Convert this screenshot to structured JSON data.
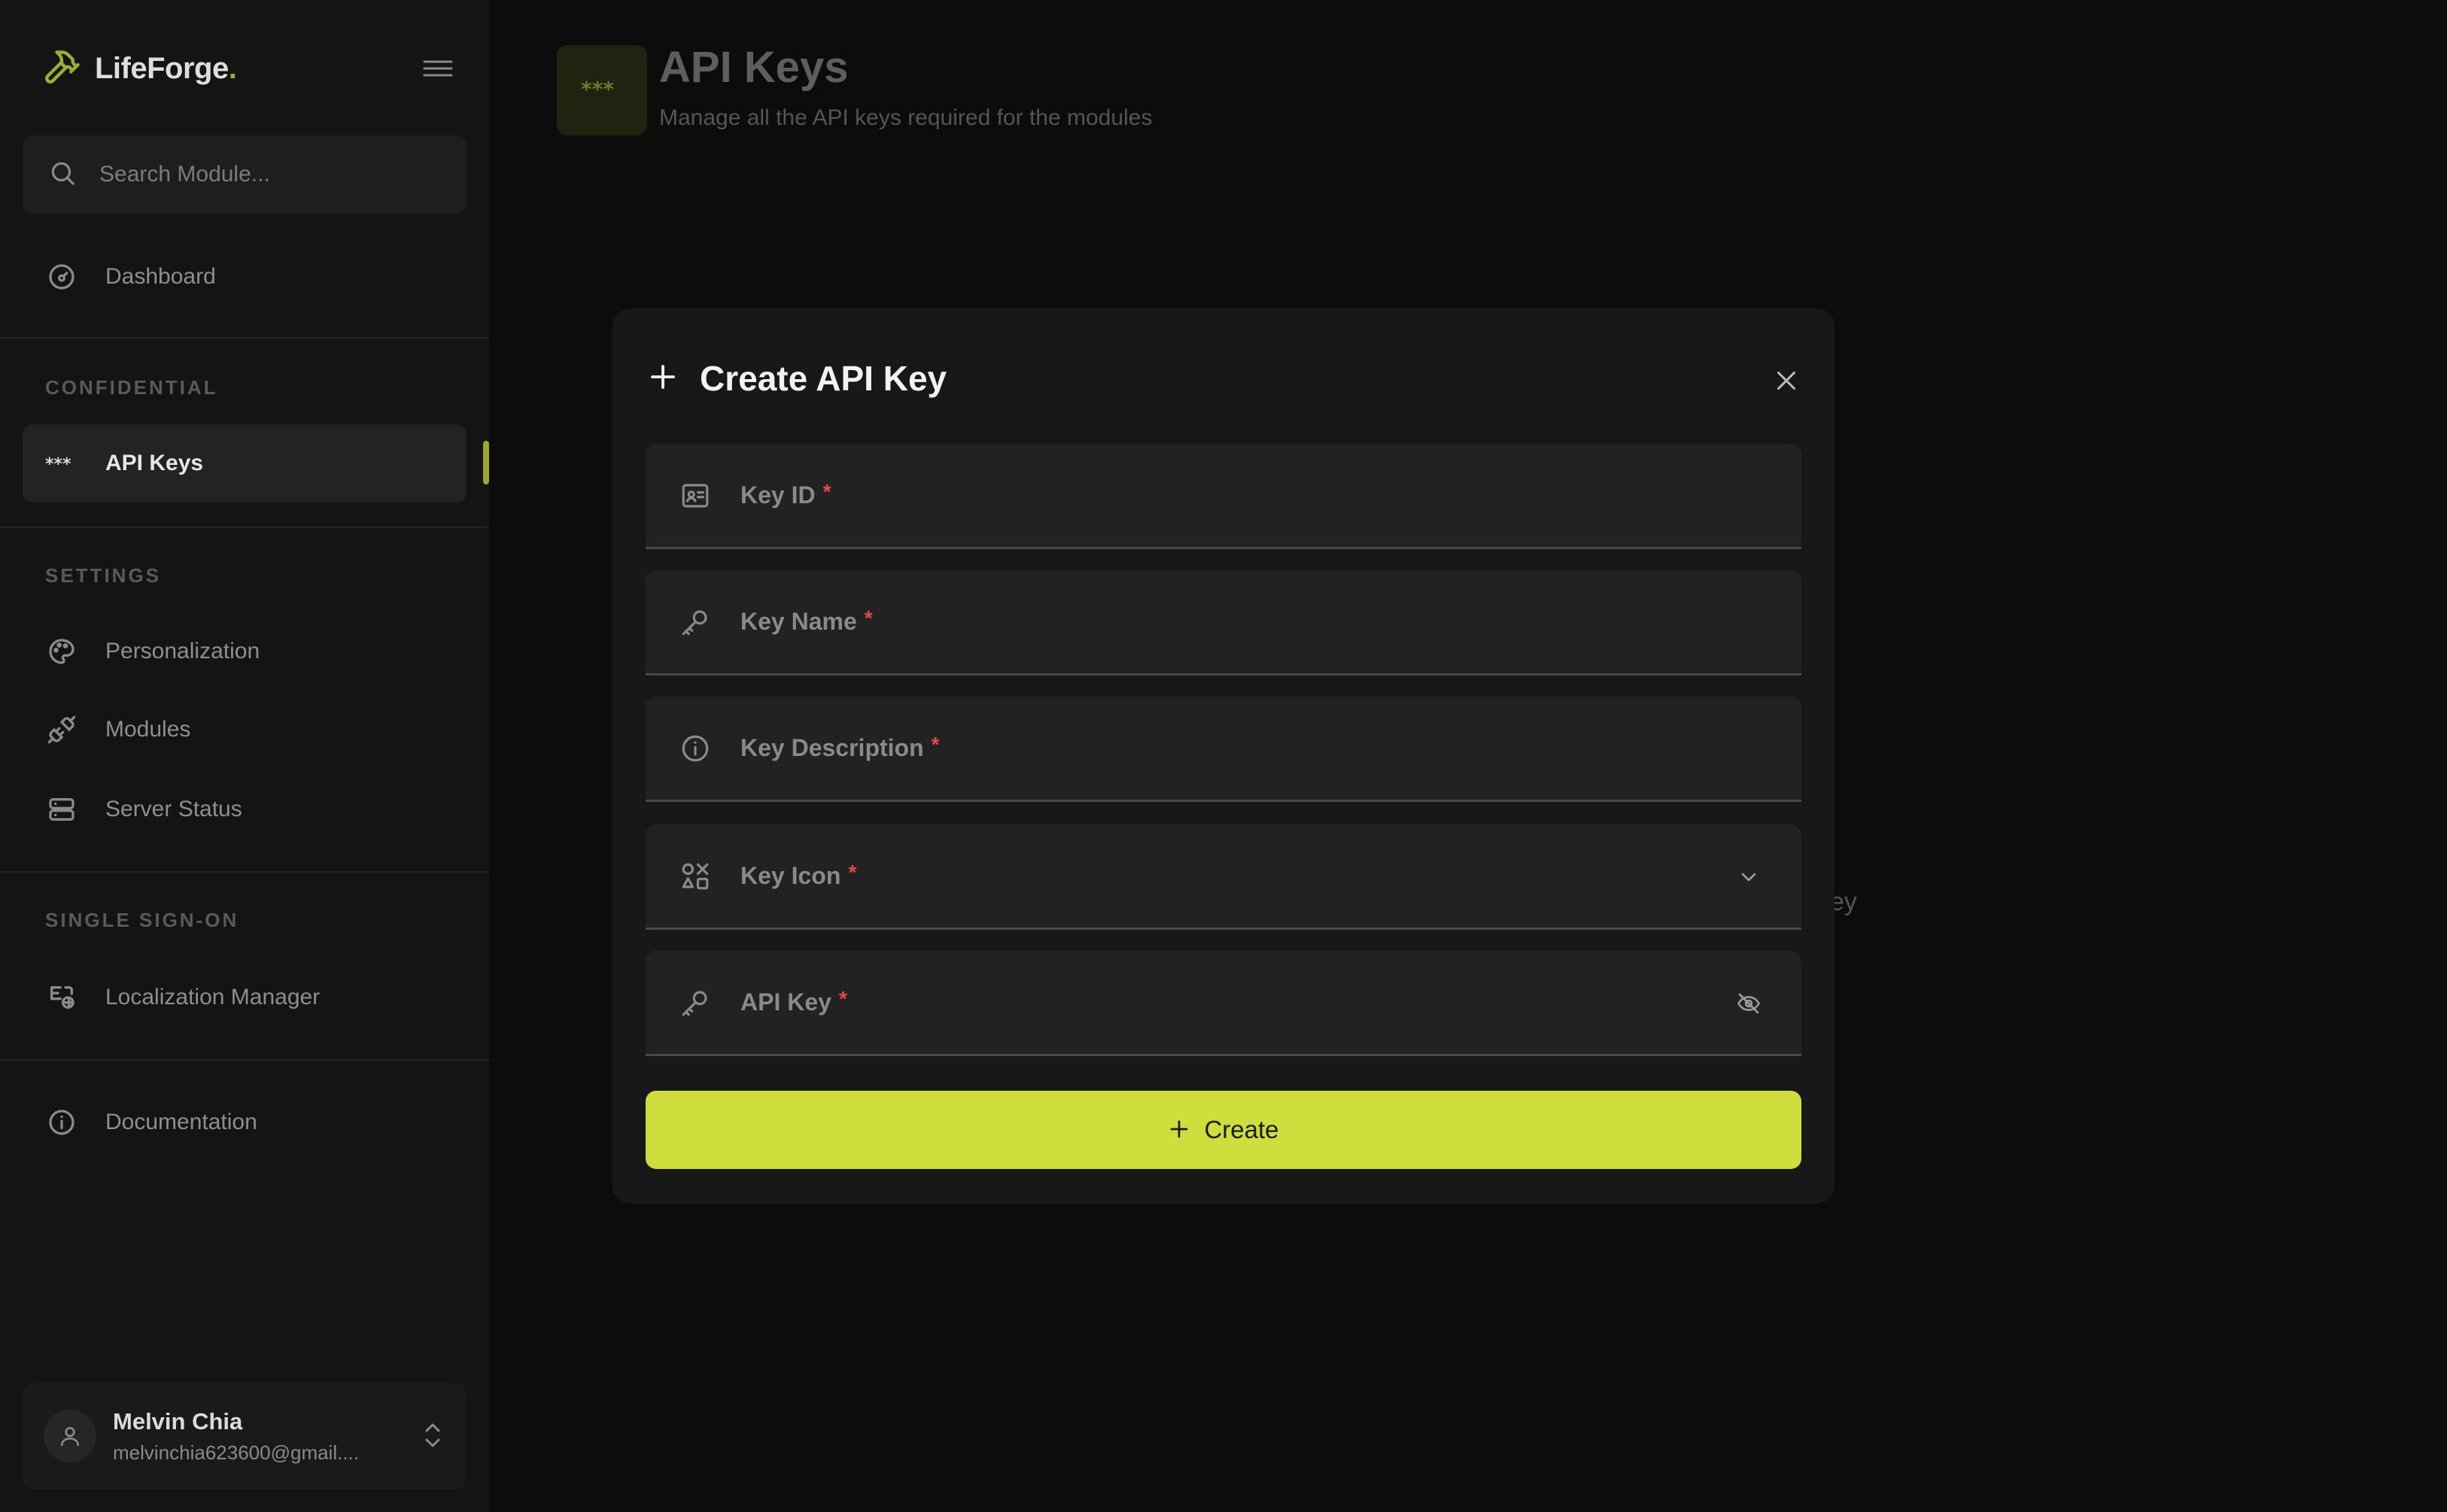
{
  "app": {
    "brand_name": "LifeForge",
    "brand_dot": ".",
    "colors": {
      "accent": "#cede3d",
      "accent_dark": "#9aa82a",
      "required": "#e5484d"
    }
  },
  "sidebar": {
    "search_placeholder": "Search Module...",
    "dashboard": {
      "label": "Dashboard",
      "icon": "dashboard-icon"
    },
    "sections": {
      "confidential": "CONFIDENTIAL",
      "settings": "SETTINGS",
      "sso": "SINGLE SIGN-ON"
    },
    "items": {
      "api_keys": {
        "label": "API Keys",
        "icon": "asterisks-icon",
        "active": true
      },
      "personalization": {
        "label": "Personalization",
        "icon": "palette-icon"
      },
      "modules": {
        "label": "Modules",
        "icon": "plug-icon"
      },
      "server_status": {
        "label": "Server Status",
        "icon": "server-icon"
      },
      "localization": {
        "label": "Localization Manager",
        "icon": "language-icon"
      },
      "documentation": {
        "label": "Documentation",
        "icon": "info-icon"
      }
    },
    "user": {
      "name": "Melvin Chia",
      "email": "melvinchia623600@gmail...."
    }
  },
  "header": {
    "title": "API Keys",
    "subtitle": "Manage all the API keys required for the modules",
    "behind_text": "ey"
  },
  "modal": {
    "title": "Create API Key",
    "fields": {
      "key_id": {
        "label": "Key ID",
        "required": "*",
        "icon": "id-card-icon"
      },
      "key_name": {
        "label": "Key Name",
        "required": "*",
        "icon": "key-icon"
      },
      "key_description": {
        "label": "Key Description",
        "required": "*",
        "icon": "info-icon"
      },
      "key_icon": {
        "label": "Key Icon",
        "required": "*",
        "icon": "shapes-icon"
      },
      "api_key": {
        "label": "API Key",
        "required": "*",
        "icon": "key-icon"
      }
    },
    "create_label": "Create"
  }
}
